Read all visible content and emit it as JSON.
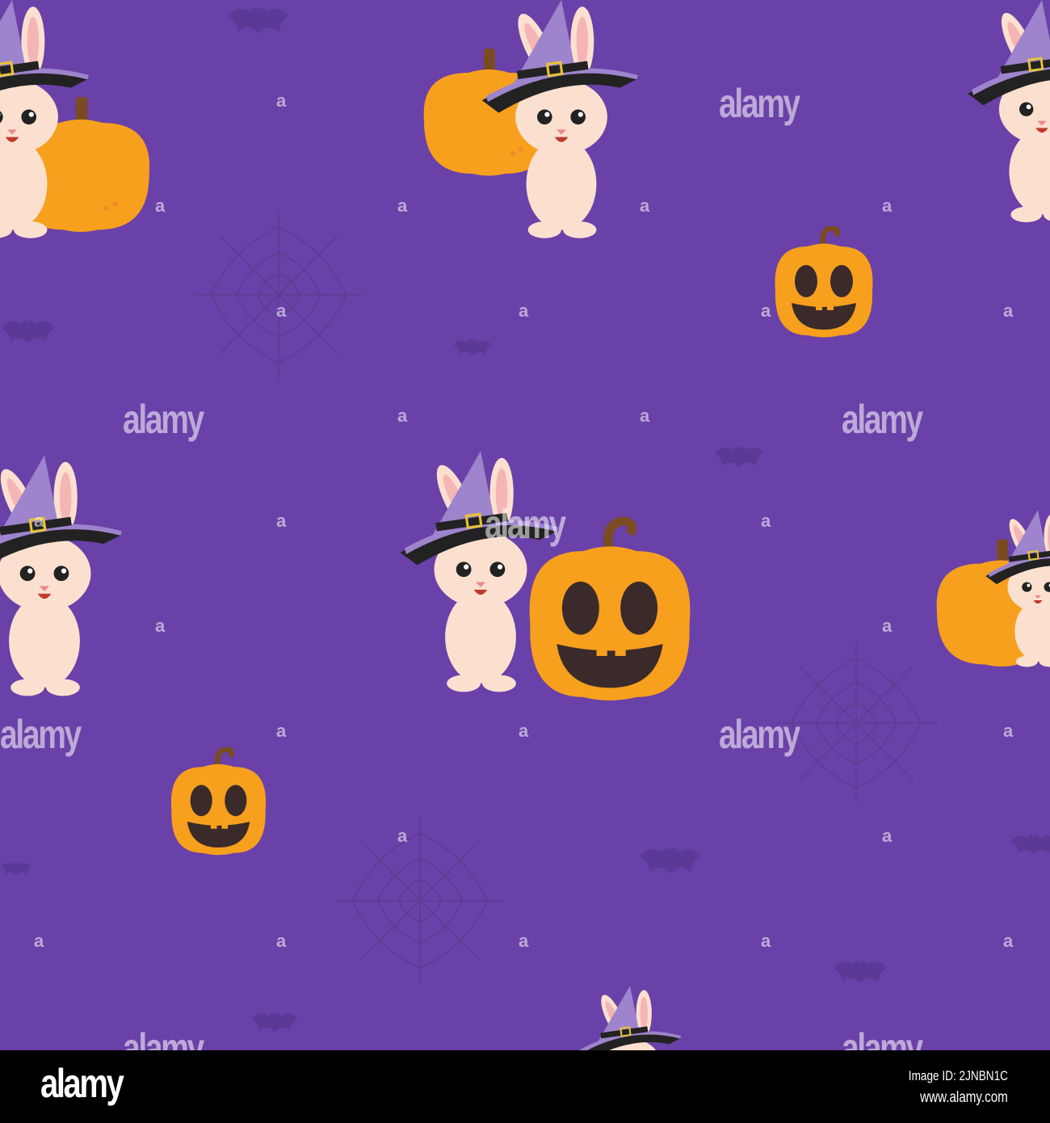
{
  "watermark": {
    "word": "alamy",
    "letter": "a"
  },
  "footer": {
    "logo": "alamy",
    "image_id": "Image ID: 2JNBN1C",
    "url": "www.alamy.com"
  },
  "colors": {
    "background": "#6a41a8",
    "pumpkin": "#f7a01e",
    "hat": "#9d84cc",
    "bunny": "#fbe0cf",
    "bat": "#5b3a97"
  }
}
